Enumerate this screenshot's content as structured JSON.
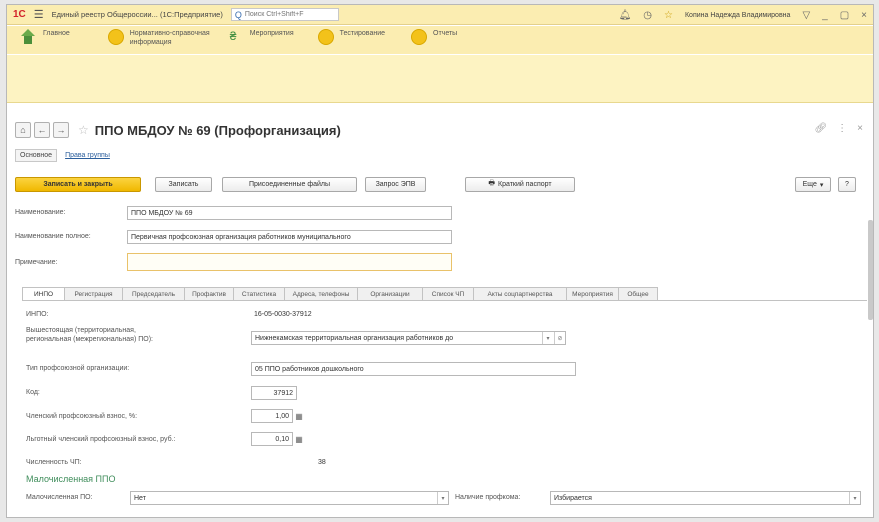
{
  "titlebar": {
    "logo": "1С",
    "title": "Единый реестр Общероссии... (1С:Предприятие)",
    "search_placeholder": "Поиск Ctrl+Shift+F",
    "user": "Копина Надежда Владимировна"
  },
  "sections": [
    {
      "label": "Главное"
    },
    {
      "label": "Нормативно-справочная\nинформация"
    },
    {
      "label": "Мероприятия"
    },
    {
      "label": "Тестирование"
    },
    {
      "label": "Отчеты"
    }
  ],
  "form": {
    "title": "ППО МБДОУ № 69 (Профорганизация)",
    "subtab_main": "Основное",
    "subtab_link": "Права группы"
  },
  "commands": {
    "save_close": "Записать и закрыть",
    "save": "Записать",
    "attached": "Присоединенные файлы",
    "egrul": "Запрос ЭПВ",
    "passport": "Краткий паспорт",
    "more": "Еще",
    "help": "?"
  },
  "fields": {
    "name_label": "Наименование:",
    "name_value": "ППО МБДОУ № 69",
    "fullname_label": "Наименование полное:",
    "fullname_value": "Первичная профсоюзная организация работников муниципального",
    "note_label": "Примечание:",
    "note_value": ""
  },
  "tabs": [
    {
      "label": "ИНПО"
    },
    {
      "label": "Регистрация"
    },
    {
      "label": "Председатель"
    },
    {
      "label": "Профактив"
    },
    {
      "label": "Статистика"
    },
    {
      "label": "Адреса, телефоны"
    },
    {
      "label": "Организации"
    },
    {
      "label": "Список ЧП"
    },
    {
      "label": "Акты соцпартнерства"
    },
    {
      "label": "Мероприятия"
    },
    {
      "label": "Общее"
    }
  ],
  "panel": {
    "inpo_label": "ИНПО:",
    "inpo_value": "16-05-0030-37912",
    "parent_label": "Вышестоящая (территориальная,\nрегиональная (межрегиональная) ПО):",
    "parent_value": "Нижнекамская территориальная организация работников до",
    "type_label": "Тип профсоюзной организации:",
    "type_value": "05  ППО работников дошкольного",
    "code_label": "Код:",
    "code_value": "37912",
    "fee_label": "Членский профсоюзный взнос, %:",
    "fee_value": "1,00",
    "lgot_label": "Льготный членский профсоюзный взнос, руб.:",
    "lgot_value": "0,10",
    "count_label": "Численность ЧП:",
    "count_value": "38",
    "group_title": "Малочисленная ППО",
    "small_label": "Малочисленная ПО:",
    "small_value": "Нет",
    "prof_label": "Наличие профкома:",
    "prof_value": "Избирается"
  }
}
